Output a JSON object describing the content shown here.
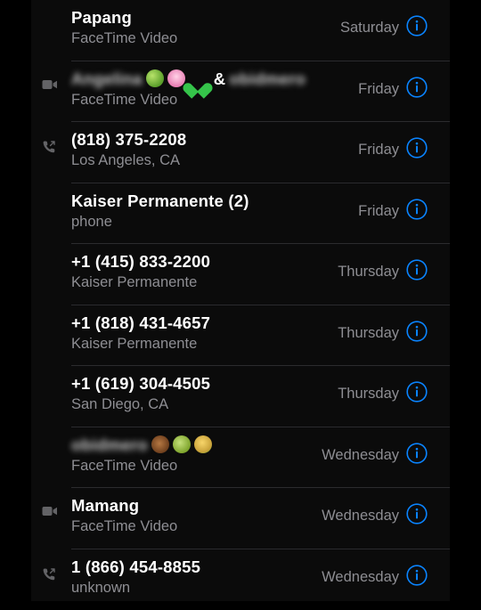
{
  "colors": {
    "background": "#000000",
    "primary_text": "#ffffff",
    "secondary_text": "#8e8e93",
    "accent": "#0a84ff",
    "separator": "#2b2b2e"
  },
  "calls": [
    {
      "name": "Papang",
      "detail": "FaceTime Video",
      "when": "Saturday",
      "type_icon": ""
    },
    {
      "name_part1": "Angelina",
      "name_part2": "&",
      "name_part3": "obidmero",
      "detail": "FaceTime Video",
      "when": "Friday",
      "type_icon": "video-camera-icon",
      "emojis": [
        "frog-face",
        "lotus",
        "green-heart"
      ]
    },
    {
      "name": "(818) 375-2208",
      "detail": "Los Angeles, CA",
      "when": "Friday",
      "type_icon": "phone-outgoing-icon"
    },
    {
      "name": "Kaiser Permanente (2)",
      "detail": "phone",
      "when": "Friday",
      "type_icon": ""
    },
    {
      "name": "+1 (415) 833-2200",
      "detail": "Kaiser Permanente",
      "when": "Thursday",
      "type_icon": ""
    },
    {
      "name": "+1 (818) 431-4657",
      "detail": "Kaiser Permanente",
      "when": "Thursday",
      "type_icon": ""
    },
    {
      "name": "+1 (619) 304-4505",
      "detail": "San Diego, CA",
      "when": "Thursday",
      "type_icon": ""
    },
    {
      "name_part1": "obidmero",
      "detail": "FaceTime Video",
      "when": "Wednesday",
      "type_icon": "",
      "emojis": [
        "pile-of-poo",
        "nauseated-face",
        "vomiting-face"
      ]
    },
    {
      "name": "Mamang",
      "detail": "FaceTime Video",
      "when": "Wednesday",
      "type_icon": "video-camera-icon"
    },
    {
      "name": "1 (866) 454-8855",
      "detail": "unknown",
      "when": "Wednesday",
      "type_icon": "phone-outgoing-icon"
    }
  ]
}
